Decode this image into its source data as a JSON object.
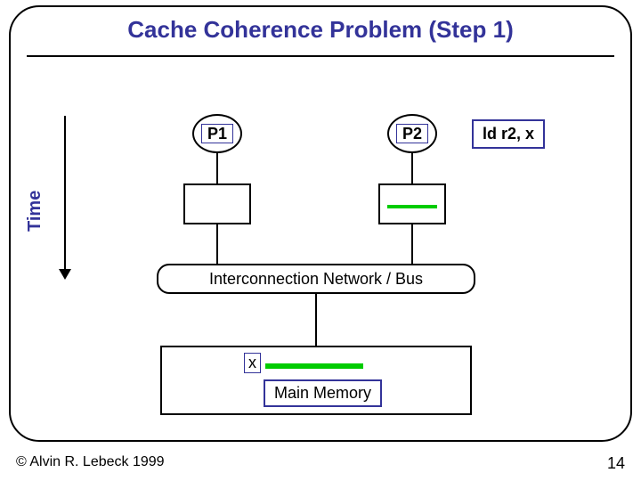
{
  "title": "Cache Coherence Problem (Step 1)",
  "time_axis_label": "Time",
  "processors": {
    "p1_label": "P1",
    "p2_label": "P2"
  },
  "instruction": "ld r2, x",
  "cache": {
    "p1_has_data": false,
    "p2_has_data": true
  },
  "bus_label": "Interconnection Network / Bus",
  "memory": {
    "var_label": "x",
    "label": "Main Memory",
    "has_data": true
  },
  "footer": {
    "copyright": "© Alvin R. Lebeck 1999",
    "page_number": "14"
  }
}
